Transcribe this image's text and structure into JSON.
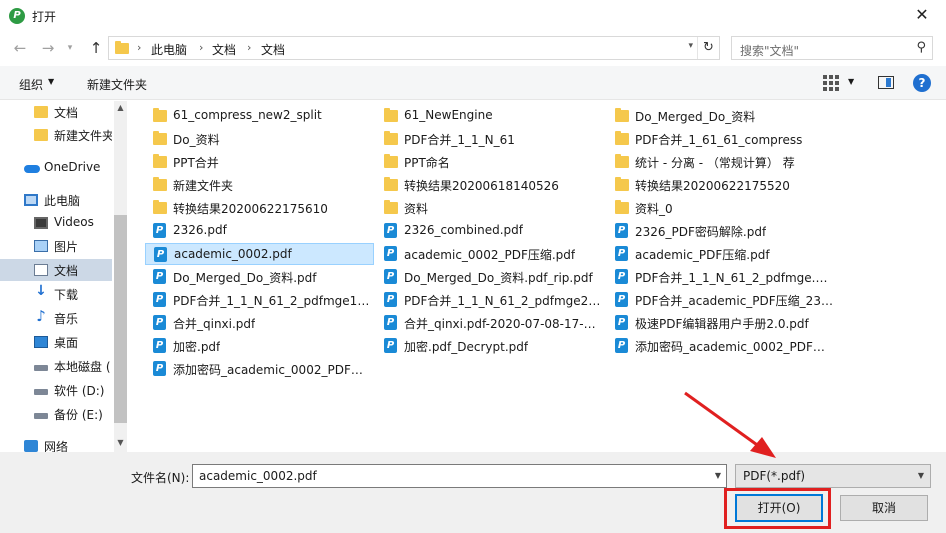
{
  "window": {
    "title": "打开"
  },
  "nav": {
    "breadcrumbs": [
      "此电脑",
      "文档",
      "文档"
    ],
    "search_placeholder": "搜索\"文档\""
  },
  "toolbar": {
    "organize": "组织",
    "new_folder": "新建文件夹"
  },
  "sidebar": {
    "items": [
      {
        "label": "文档",
        "icon": "folder-icon"
      },
      {
        "label": "新建文件夹",
        "icon": "folder-icon"
      },
      {
        "label": "OneDrive",
        "icon": "cloud-icon"
      },
      {
        "label": "此电脑",
        "icon": "computer-icon"
      },
      {
        "label": "Videos",
        "icon": "video-icon"
      },
      {
        "label": "图片",
        "icon": "picture-icon"
      },
      {
        "label": "文档",
        "icon": "document-icon"
      },
      {
        "label": "下载",
        "icon": "download-icon"
      },
      {
        "label": "音乐",
        "icon": "music-icon"
      },
      {
        "label": "桌面",
        "icon": "desktop-icon"
      },
      {
        "label": "本地磁盘 (",
        "icon": "drive-icon"
      },
      {
        "label": "软件 (D:)",
        "icon": "drive-icon"
      },
      {
        "label": "备份 (E:)",
        "icon": "drive-icon"
      },
      {
        "label": "网络",
        "icon": "network-icon"
      }
    ],
    "selected_index": 6
  },
  "files": [
    {
      "name": "61_compress_new2_split",
      "type": "folder"
    },
    {
      "name": "61_NewEngine",
      "type": "folder"
    },
    {
      "name": "Do_Merged_Do_资料",
      "type": "folder"
    },
    {
      "name": "Do_资料",
      "type": "folder"
    },
    {
      "name": "PDF合并_1_1_N_61",
      "type": "folder"
    },
    {
      "name": "PDF合并_1_61_61_compress",
      "type": "folder"
    },
    {
      "name": "PPT合并",
      "type": "folder"
    },
    {
      "name": "PPT命名",
      "type": "folder"
    },
    {
      "name": "统计 - 分离 - （常规计算） 荐",
      "type": "folder"
    },
    {
      "name": "新建文件夹",
      "type": "folder"
    },
    {
      "name": "转换结果20200618140526",
      "type": "folder"
    },
    {
      "name": "转换结果20200622175520",
      "type": "folder"
    },
    {
      "name": "转换结果20200622175610",
      "type": "folder"
    },
    {
      "name": "资料",
      "type": "folder"
    },
    {
      "name": "资料_0",
      "type": "folder"
    },
    {
      "name": "2326.pdf",
      "type": "pdf"
    },
    {
      "name": "2326_combined.pdf",
      "type": "pdf"
    },
    {
      "name": "2326_PDF密码解除.pdf",
      "type": "pdf"
    },
    {
      "name": "academic_0002.pdf",
      "type": "pdf",
      "selected": true
    },
    {
      "name": "academic_0002_PDF压缩.pdf",
      "type": "pdf"
    },
    {
      "name": "academic_PDF压缩.pdf",
      "type": "pdf"
    },
    {
      "name": "Do_Merged_Do_资料.pdf",
      "type": "pdf"
    },
    {
      "name": "Do_Merged_Do_资料.pdf_rip.pdf",
      "type": "pdf"
    },
    {
      "name": "PDF合并_1_1_N_61_2_pdfmge.pdf",
      "type": "pdf"
    },
    {
      "name": "PDF合并_1_1_N_61_2_pdfmge1_sp...",
      "type": "pdf"
    },
    {
      "name": "PDF合并_1_1_N_61_2_pdfmge2_sp...",
      "type": "pdf"
    },
    {
      "name": "PDF合并_academic_PDF压缩_2326....",
      "type": "pdf"
    },
    {
      "name": "合并_qinxi.pdf",
      "type": "pdf"
    },
    {
      "name": "合并_qinxi.pdf-2020-07-08-17-43-...",
      "type": "pdf"
    },
    {
      "name": "极速PDF编辑器用户手册2.0.pdf",
      "type": "pdf"
    },
    {
      "name": "加密.pdf",
      "type": "pdf"
    },
    {
      "name": "加密.pdf_Decrypt.pdf",
      "type": "pdf"
    },
    {
      "name": "添加密码_academic_0002_PDF压缩...",
      "type": "pdf"
    },
    {
      "name": "添加密码_academic_0002_PDF压缩...",
      "type": "pdf"
    }
  ],
  "bottom": {
    "filename_label": "文件名(N):",
    "filename_value": "academic_0002.pdf",
    "filetype_value": "PDF(*.pdf)",
    "open_label": "打开(O)",
    "cancel_label": "取消"
  },
  "colors": {
    "selection_bg": "#cce8ff",
    "nav_selected_bg": "#ccd8e6",
    "folder": "#f5c84c",
    "pdf_icon": "#1a8ad6",
    "accent": "#0078d7",
    "annotation_red": "#e02020"
  }
}
